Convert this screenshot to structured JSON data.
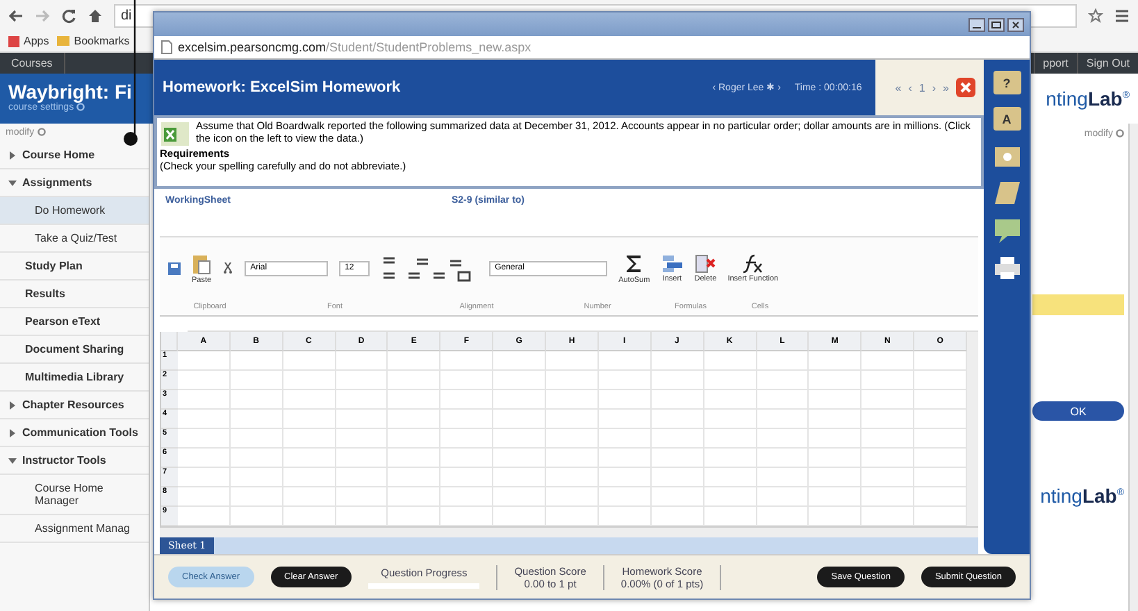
{
  "browser": {
    "url": "di",
    "bookmarks": [
      "Apps",
      "Bookmarks"
    ]
  },
  "page": {
    "nav": {
      "left": "Courses",
      "right": [
        "pport",
        "Sign Out"
      ]
    },
    "course_title": "Waybright: Fi",
    "course_settings": "course settings",
    "logo": {
      "main": "nting",
      "accent": "Lab",
      "mark": "®"
    },
    "modify": "modify",
    "right_modify": "modify",
    "ok": "OK",
    "bottom_logo": {
      "main": "nting",
      "accent": "Lab",
      "mark": "®"
    },
    "sidebar": [
      {
        "kind": "section",
        "label": "Course Home",
        "expanded": false
      },
      {
        "kind": "section",
        "label": "Assignments",
        "expanded": true
      },
      {
        "kind": "sub",
        "label": "Do Homework",
        "selected": true
      },
      {
        "kind": "sub",
        "label": "Take a Quiz/Test",
        "selected": false
      },
      {
        "kind": "plain",
        "label": "Study Plan"
      },
      {
        "kind": "plain",
        "label": "Results"
      },
      {
        "kind": "plain",
        "label": "Pearson eText"
      },
      {
        "kind": "plain",
        "label": "Document Sharing"
      },
      {
        "kind": "plain",
        "label": "Multimedia Library"
      },
      {
        "kind": "section",
        "label": "Chapter Resources",
        "expanded": false
      },
      {
        "kind": "section",
        "label": "Communication Tools",
        "expanded": false
      },
      {
        "kind": "section",
        "label": "Instructor Tools",
        "expanded": true
      },
      {
        "kind": "sub",
        "label": "Course Home Manager",
        "selected": false
      },
      {
        "kind": "sub",
        "label": "Assignment Manag",
        "selected": false
      }
    ]
  },
  "popup": {
    "url_host": "excelsim.pearsoncmg.com",
    "url_path": "/Student/StudentProblems_new.aspx",
    "title": "Homework: ExcelSim Homework",
    "student": "‹ Roger Lee ✱ ›",
    "time": "Time : 00:00:16",
    "pager": [
      "«",
      "‹",
      "1",
      "›",
      "»"
    ],
    "question": "Assume that Old Boardwalk reported the following summarized data at December 31, 2012. Accounts appear in no particular order; dollar amounts are in millions. (Click the icon on the left to view the data.)",
    "req_title": "Requirements",
    "req_text": "(Check your spelling carefully and do not abbreviate.)",
    "sheet_title": "WorkingSheet",
    "problem": "S2-9 (similar to)",
    "font": "Arial",
    "size": "12",
    "format": "General",
    "buttons": [
      {
        "kind": "paste",
        "label": "Paste"
      },
      {
        "kind": "sum",
        "label": "AutoSum"
      },
      {
        "kind": "insert",
        "label": "Insert"
      },
      {
        "kind": "delete",
        "label": "Delete"
      },
      {
        "kind": "fx",
        "label": "Insert Function"
      }
    ],
    "groups": [
      "Clipboard",
      "Font",
      "Alignment",
      "Number",
      "Formulas",
      "Cells"
    ],
    "columns": [
      "A",
      "B",
      "C",
      "D",
      "E",
      "F",
      "G",
      "H",
      "I",
      "J",
      "K",
      "L",
      "M",
      "N",
      "O"
    ],
    "rows": [
      "1",
      "2",
      "3",
      "4",
      "5",
      "6",
      "7",
      "8",
      "9"
    ],
    "sheet_tab": "Sheet 1",
    "tools": [
      {
        "kind": "help",
        "label": "?"
      },
      {
        "kind": "letter",
        "label": "A"
      },
      {
        "kind": "box"
      },
      {
        "kind": "note"
      },
      {
        "kind": "chat"
      },
      {
        "kind": "print"
      }
    ],
    "footer": {
      "check": {
        "label": "Check Answer",
        "disabled": true
      },
      "clear": "Clear Answer",
      "progress_label": "Question Progress",
      "progress": {
        "level": 0
      },
      "qscore_label": "Question Score",
      "qscore": "0.00 to 1 pt",
      "hscore_label": "Homework Score",
      "hscore": "0.00% (0 of 1 pts)",
      "save": "Save Question",
      "submit": "Submit Question"
    }
  }
}
